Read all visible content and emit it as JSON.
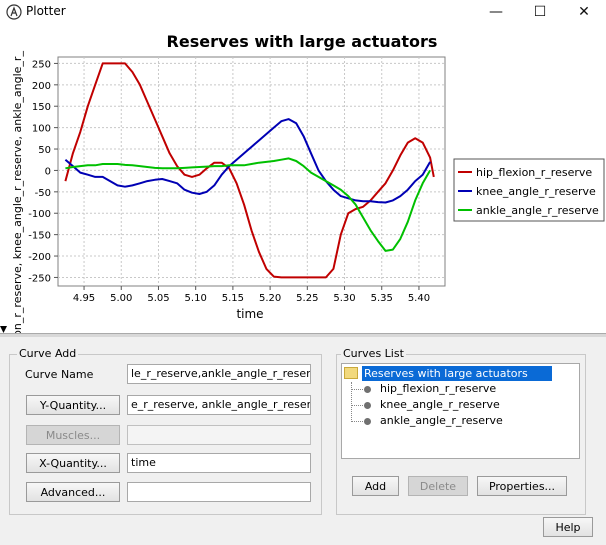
{
  "window": {
    "title": "Plotter",
    "controls": [
      "—",
      "☐",
      "✕"
    ]
  },
  "chart_data": {
    "type": "line",
    "title": "Reserves with large actuators",
    "xlabel": "time",
    "ylabel": "hip_flexion_r_reserve, knee_angle_r_reserve, ankle_angle_r_reserve",
    "ylabel_visible": "exion_r_reserve, knee_angle_r_reserve, ankle_angle_r_",
    "xlim": [
      4.915,
      4.435
    ],
    "ylim": [
      -270,
      265
    ],
    "xticks": [
      "4.95",
      "5.00",
      "5.05",
      "5.10",
      "5.15",
      "5.20",
      "5.25",
      "5.30",
      "5.35",
      "5.40"
    ],
    "xtick_values": [
      4.95,
      5.0,
      5.05,
      5.1,
      5.15,
      5.2,
      5.25,
      5.3,
      5.35,
      5.4
    ],
    "yticks": [
      250,
      200,
      150,
      100,
      50,
      0,
      -50,
      -100,
      -150,
      -200,
      -250
    ],
    "grid": true,
    "legend_position": "right",
    "series": [
      {
        "name": "hip_flexion_r_reserve",
        "color": "#c00000",
        "x": [
          4.925,
          4.935,
          4.945,
          4.955,
          4.965,
          4.975,
          4.985,
          4.995,
          5.005,
          5.015,
          5.025,
          5.035,
          5.045,
          5.055,
          5.065,
          5.075,
          5.085,
          5.095,
          5.105,
          5.115,
          5.125,
          5.135,
          5.145,
          5.155,
          5.165,
          5.175,
          5.185,
          5.195,
          5.205,
          5.215,
          5.225,
          5.235,
          5.245,
          5.255,
          5.265,
          5.275,
          5.285,
          5.295,
          5.305,
          5.315,
          5.325,
          5.335,
          5.345,
          5.355,
          5.365,
          5.375,
          5.385,
          5.395,
          5.405,
          5.415,
          5.42
        ],
        "y": [
          -25,
          40,
          90,
          150,
          200,
          250,
          250,
          250,
          250,
          230,
          200,
          160,
          120,
          80,
          40,
          10,
          -10,
          -15,
          -10,
          5,
          18,
          18,
          5,
          -30,
          -80,
          -140,
          -190,
          -230,
          -248,
          -250,
          -250,
          -250,
          -250,
          -250,
          -250,
          -250,
          -230,
          -150,
          -100,
          -90,
          -85,
          -70,
          -50,
          -30,
          0,
          35,
          65,
          75,
          65,
          30,
          -15
        ]
      },
      {
        "name": "knee_angle_r_reserve",
        "color": "#0000b4",
        "x": [
          4.925,
          4.935,
          4.945,
          4.955,
          4.965,
          4.975,
          4.985,
          4.995,
          5.005,
          5.015,
          5.025,
          5.035,
          5.045,
          5.055,
          5.065,
          5.075,
          5.085,
          5.095,
          5.105,
          5.115,
          5.125,
          5.135,
          5.145,
          5.155,
          5.165,
          5.175,
          5.185,
          5.195,
          5.205,
          5.215,
          5.225,
          5.235,
          5.245,
          5.255,
          5.265,
          5.275,
          5.285,
          5.295,
          5.305,
          5.315,
          5.325,
          5.335,
          5.345,
          5.355,
          5.365,
          5.375,
          5.385,
          5.395,
          5.405,
          5.415
        ],
        "y": [
          25,
          10,
          -5,
          -10,
          -15,
          -15,
          -25,
          -35,
          -38,
          -35,
          -30,
          -25,
          -22,
          -20,
          -25,
          -30,
          -45,
          -52,
          -55,
          -50,
          -35,
          -10,
          10,
          25,
          40,
          55,
          70,
          85,
          100,
          115,
          120,
          110,
          80,
          40,
          0,
          -25,
          -45,
          -60,
          -65,
          -70,
          -72,
          -72,
          -74,
          -75,
          -70,
          -60,
          -45,
          -25,
          -10,
          20
        ]
      },
      {
        "name": "ankle_angle_r_reserve",
        "color": "#00c000",
        "x": [
          4.925,
          4.935,
          4.945,
          4.955,
          4.965,
          4.975,
          4.985,
          4.995,
          5.005,
          5.015,
          5.025,
          5.035,
          5.045,
          5.055,
          5.065,
          5.075,
          5.085,
          5.095,
          5.105,
          5.115,
          5.125,
          5.135,
          5.145,
          5.155,
          5.165,
          5.175,
          5.185,
          5.195,
          5.205,
          5.215,
          5.225,
          5.235,
          5.245,
          5.255,
          5.265,
          5.275,
          5.285,
          5.295,
          5.305,
          5.315,
          5.325,
          5.335,
          5.345,
          5.355,
          5.365,
          5.375,
          5.385,
          5.395,
          5.405,
          5.415
        ],
        "y": [
          5,
          8,
          10,
          12,
          12,
          15,
          15,
          15,
          13,
          12,
          10,
          8,
          6,
          5,
          5,
          5,
          6,
          7,
          8,
          9,
          10,
          10,
          12,
          12,
          12,
          15,
          18,
          20,
          22,
          25,
          28,
          22,
          10,
          -5,
          -15,
          -25,
          -35,
          -45,
          -60,
          -80,
          -110,
          -140,
          -165,
          -188,
          -185,
          -160,
          -120,
          -70,
          -30,
          0
        ]
      }
    ]
  },
  "curve_add": {
    "group_title": "Curve Add",
    "curve_name_label": "Curve Name",
    "curve_name_value": "le_r_reserve,ankle_angle_r_reserve",
    "y_quantity_button": "Y-Quantity...",
    "y_quantity_value": "e_r_reserve, ankle_angle_r_reserve",
    "muscles_button": "Muscles...",
    "muscles_value": "",
    "x_quantity_button": "X-Quantity...",
    "x_quantity_value": "time",
    "advanced_button": "Advanced...",
    "advanced_value": ""
  },
  "curves_list": {
    "group_title": "Curves List",
    "root": "Reserves with large actuators",
    "items": [
      "hip_flexion_r_reserve",
      "knee_angle_r_reserve",
      "ankle_angle_r_reserve"
    ],
    "add_button": "Add",
    "delete_button": "Delete",
    "properties_button": "Properties..."
  },
  "help_button": "Help"
}
